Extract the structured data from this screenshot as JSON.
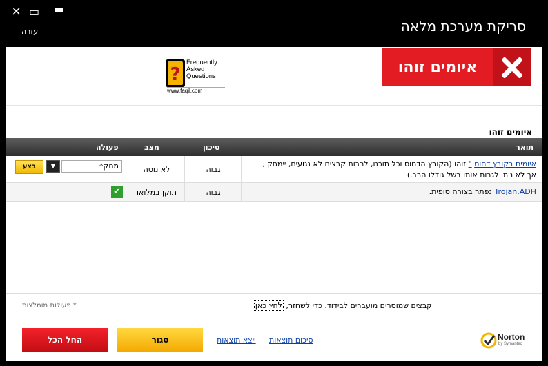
{
  "window": {
    "title": "סריקת מערכת מלאה",
    "help_label": "עזרה",
    "close_glyph": "✕",
    "restore_glyph": "▭",
    "minimize_glyph": "▬"
  },
  "banner": {
    "threat_label": "איומים זוהו",
    "threat_icon": "x-icon",
    "faq": {
      "line1": "Frequently",
      "line2": "Asked",
      "line3": "Questions",
      "url": "www.faqil.com"
    }
  },
  "section_title": "איומים זוהו",
  "table": {
    "headers": {
      "description": "תואר",
      "risk": "סיכון",
      "status": "מצב",
      "action": "פעולה"
    },
    "rows": [
      {
        "link": "איומים בקובץ דחוס",
        "quote_link": "\"",
        "text": " זוהו (הקובץ הדחוס וכל תוכנו, לרבות קבצים לא נגועים, יימחקו, אך לא ניתן לגבות אותו בשל גודלו הרב.)",
        "risk": "גבוה",
        "status": "לא נוסה",
        "action_value": "מחק*",
        "action_button": "בצע"
      },
      {
        "link": "Trojan.ADH",
        "text": " נפתר בצורה סופית.",
        "risk": "גבוה",
        "status": "תוקן במלואו",
        "check_glyph": "✔"
      }
    ]
  },
  "footer_note": {
    "text": "קבצים שמוסרים מועברים לבידוד. כדי לשחזר,",
    "link": "לחץ כאן",
    "recommended": "* פעולות מומלצות"
  },
  "bottom": {
    "start_all": "החל הכל",
    "close": "סגור",
    "export": "ייצא תוצאות",
    "summary": "סיכום תוצאות",
    "norton_name": "Norton",
    "norton_sub": "by Symantec"
  },
  "colors": {
    "threat_red": "#e31b23",
    "action_yellow": "#f4b800",
    "link_blue": "#0a3fa8",
    "ok_green": "#2ea02e"
  }
}
